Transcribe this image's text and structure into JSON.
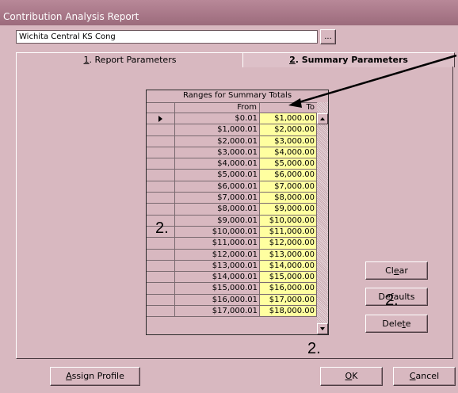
{
  "window": {
    "title": "Contribution Analysis Report"
  },
  "congregation": {
    "value": "Wichita Central KS Cong",
    "browse_label": "..."
  },
  "tabs": [
    {
      "hotkey": "1",
      "rest": ". Report Parameters"
    },
    {
      "hotkey": "2",
      "rest": ". Summary Parameters"
    }
  ],
  "grid": {
    "title": "Ranges for Summary Totals",
    "col_from": "From",
    "col_to": "To",
    "rows": [
      {
        "from": "$0.01",
        "to": "$1,000.00"
      },
      {
        "from": "$1,000.01",
        "to": "$2,000.00"
      },
      {
        "from": "$2,000.01",
        "to": "$3,000.00"
      },
      {
        "from": "$3,000.01",
        "to": "$4,000.00"
      },
      {
        "from": "$4,000.01",
        "to": "$5,000.00"
      },
      {
        "from": "$5,000.01",
        "to": "$6,000.00"
      },
      {
        "from": "$6,000.01",
        "to": "$7,000.00"
      },
      {
        "from": "$7,000.01",
        "to": "$8,000.00"
      },
      {
        "from": "$8,000.01",
        "to": "$9,000.00"
      },
      {
        "from": "$9,000.01",
        "to": "$10,000.00"
      },
      {
        "from": "$10,000.01",
        "to": "$11,000.00"
      },
      {
        "from": "$11,000.01",
        "to": "$12,000.00"
      },
      {
        "from": "$12,000.01",
        "to": "$13,000.00"
      },
      {
        "from": "$13,000.01",
        "to": "$14,000.00"
      },
      {
        "from": "$14,000.01",
        "to": "$15,000.00"
      },
      {
        "from": "$15,000.01",
        "to": "$16,000.00"
      },
      {
        "from": "$16,000.01",
        "to": "$17,000.00"
      },
      {
        "from": "$17,000.01",
        "to": "$18,000.00"
      }
    ]
  },
  "buttons": {
    "clear": {
      "pre": "Cl",
      "hotkey": "e",
      "post": "ar"
    },
    "defaults": {
      "pre": "De",
      "hotkey": "f",
      "post": "aults"
    },
    "delete": {
      "pre": "Dele",
      "hotkey": "t",
      "post": "e"
    },
    "assign": {
      "pre": "",
      "hotkey": "A",
      "post": "ssign Profile"
    },
    "ok": {
      "pre": "",
      "hotkey": "O",
      "post": "K"
    },
    "cancel": {
      "pre": "",
      "hotkey": "C",
      "post": "ancel"
    }
  },
  "annotations": [
    "2.",
    "2.",
    "2."
  ]
}
